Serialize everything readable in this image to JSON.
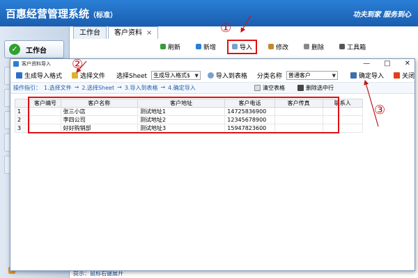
{
  "app": {
    "title": "百惠经营管理系统",
    "edition": "（标准）",
    "slogan": "功夫到家  服务到心",
    "worktable_label": "工作台",
    "hint": "提示：鼠标右键展开"
  },
  "bg_tabs": [
    {
      "label": "工作台"
    },
    {
      "label": "客户资料",
      "close": "×"
    }
  ],
  "bg_toolbar": [
    {
      "label": "刷新",
      "color": "#3a9a3a"
    },
    {
      "label": "新增",
      "color": "#2a7fd6"
    },
    {
      "label": "导入",
      "color": "#7aa0d0"
    },
    {
      "label": "修改",
      "color": "#c08a2a"
    },
    {
      "label": "删除",
      "color": "#888888"
    },
    {
      "label": "工具箱",
      "color": "#555555"
    }
  ],
  "markers": {
    "one": "①",
    "two": "②",
    "three": "③"
  },
  "dialog": {
    "title": "客户资料导入",
    "win_buttons": [
      "—",
      "□",
      "✕"
    ],
    "toolbar": {
      "gen_format": "生成导入格式",
      "choose_file": "选择文件",
      "sheet_label": "选择Sheet",
      "sheet_value": "生成导入格式$",
      "import_to_table": "导入到表格",
      "category_label": "分类名称",
      "category_value": "普通客户",
      "confirm_import": "确定导入",
      "close": "关闭"
    },
    "guide": {
      "prefix": "操作指引：",
      "step1": "1.选择文件",
      "step2": "2.选择Sheet",
      "step3": "3.导入到表格",
      "step4": "4.确定导入",
      "arrow": "→",
      "clear_table": "清空表格",
      "delete_row": "删除选中行"
    },
    "table": {
      "headers": [
        "客户编号",
        "客户名称",
        "客户地址",
        "客户电话",
        "客户传真",
        "联系人"
      ],
      "rows": [
        {
          "num": "1",
          "cells": [
            "",
            "张三小店",
            "测试地址1",
            "14725836900",
            "",
            ""
          ]
        },
        {
          "num": "2",
          "cells": [
            "",
            "李四公司",
            "测试地址2",
            "12345678900",
            "",
            ""
          ]
        },
        {
          "num": "3",
          "cells": [
            "",
            "好好购销部",
            "测试地址3",
            "15947823600",
            "",
            ""
          ]
        }
      ]
    }
  },
  "colors": {
    "accent_red": "#e01010",
    "header_blue": "#1a5eb0",
    "guide_blue": "#1f5fb0"
  }
}
